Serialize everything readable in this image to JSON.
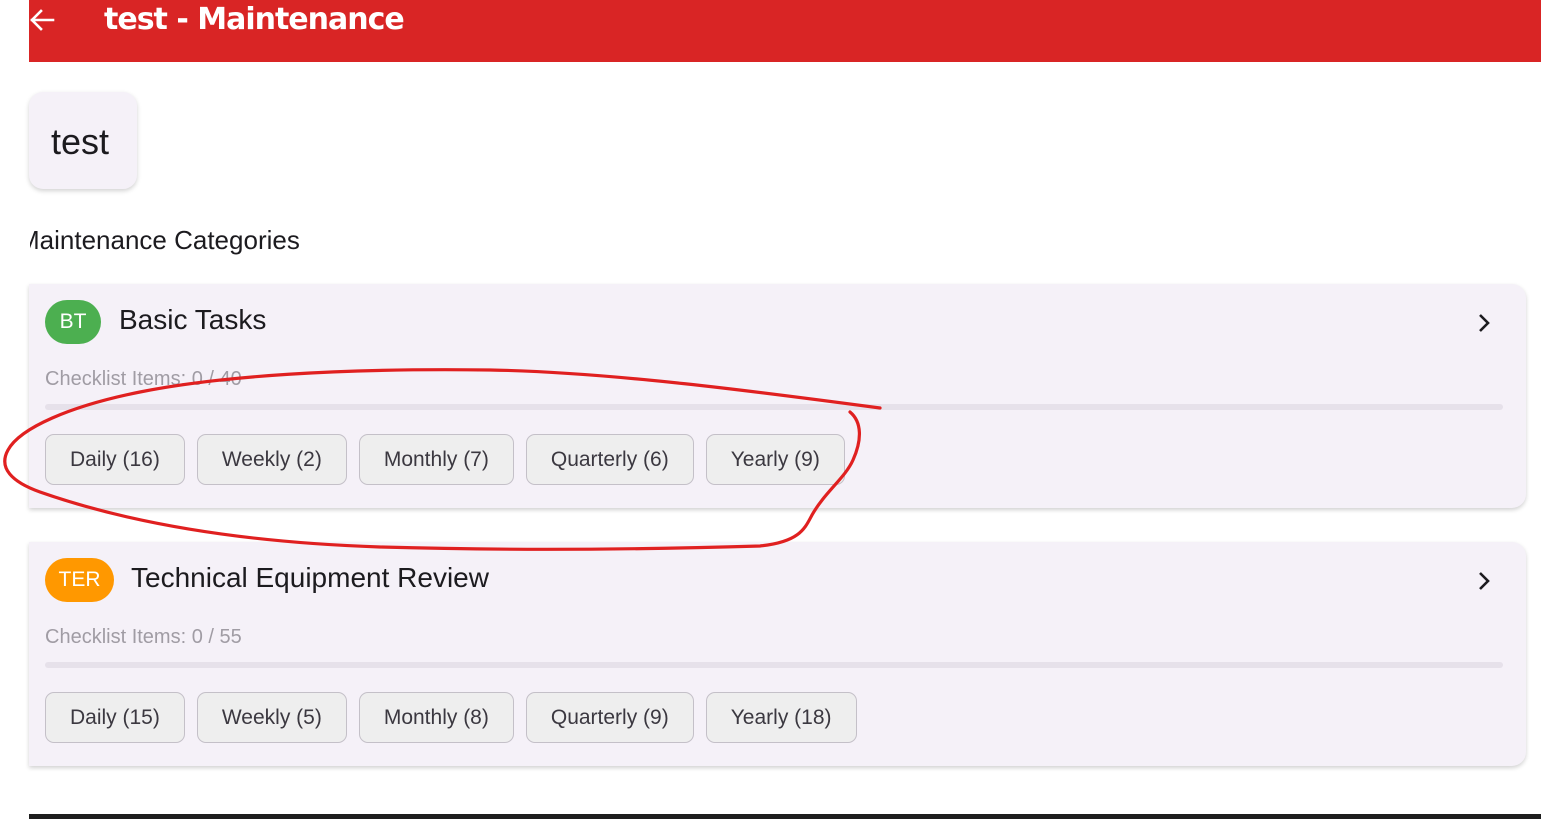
{
  "appbar": {
    "title": "test - Maintenance",
    "back_icon": "arrow-left-icon",
    "background": "#d92525"
  },
  "site": {
    "name": "test"
  },
  "section": {
    "title": "Maintenance Categories"
  },
  "categories": [
    {
      "initials": "BT",
      "badge_color": "#4caf50",
      "name": "Basic Tasks",
      "progress_label": "Checklist Items: 0 / 40",
      "progress_fraction": 0,
      "chevron_icon": "chevron-right-icon",
      "chips": [
        "Daily (16)",
        "Weekly (2)",
        "Monthly (7)",
        "Quarterly (6)",
        "Yearly (9)"
      ]
    },
    {
      "initials": "TER",
      "badge_color": "#ff9800",
      "name": "Technical Equipment Review",
      "progress_label": "Checklist Items: 0 / 55",
      "progress_fraction": 0,
      "chevron_icon": "chevron-right-icon",
      "chips": [
        "Daily (15)",
        "Weekly (5)",
        "Monthly (8)",
        "Quarterly (9)",
        "Yearly (18)"
      ]
    }
  ],
  "annotation": {
    "shape": "hand-drawn ellipse around Basic Tasks frequency chips",
    "color": "#e02020"
  }
}
